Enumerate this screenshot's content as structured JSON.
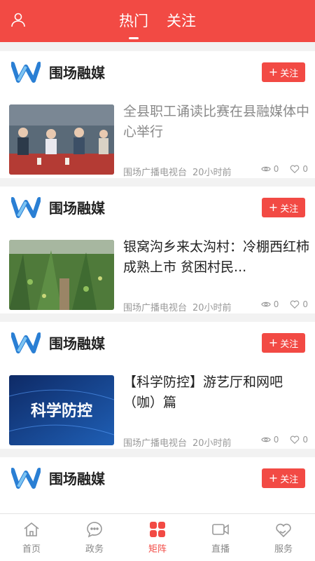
{
  "header": {
    "tabs": [
      {
        "label": "热门",
        "active": true
      },
      {
        "label": "关注",
        "active": false
      }
    ],
    "user_icon": "user-icon"
  },
  "feed": {
    "cards": [
      {
        "source": "围场融媒",
        "follow_label": "关注",
        "title": "全县职工诵读比赛在县融媒体中心举行",
        "title_read": true,
        "publisher": "围场广播电视台",
        "time": "20小时前",
        "views": "0",
        "likes": "0"
      },
      {
        "source": "围场融媒",
        "follow_label": "关注",
        "title": "银窝沟乡来太沟村：冷棚西红柿成熟上市 贫困村民...",
        "title_read": false,
        "publisher": "围场广播电视台",
        "time": "20小时前",
        "views": "0",
        "likes": "0"
      },
      {
        "source": "围场融媒",
        "follow_label": "关注",
        "title": "【科学防控】游艺厅和网吧（咖）篇",
        "title_read": false,
        "thumb_text": "科学防控",
        "publisher": "围场广播电视台",
        "time": "20小时前",
        "views": "0",
        "likes": "0"
      },
      {
        "source": "围场融媒",
        "follow_label": "关注"
      }
    ]
  },
  "bottom_nav": [
    {
      "label": "首页",
      "icon": "home-icon",
      "active": false
    },
    {
      "label": "政务",
      "icon": "chat-bubble-icon",
      "active": false
    },
    {
      "label": "矩阵",
      "icon": "grid-icon",
      "active": true
    },
    {
      "label": "直播",
      "icon": "video-camera-icon",
      "active": false
    },
    {
      "label": "服务",
      "icon": "heart-hand-icon",
      "active": false
    }
  ],
  "colors": {
    "accent": "#f24a44",
    "logo_blue": "#2a7fd4"
  }
}
